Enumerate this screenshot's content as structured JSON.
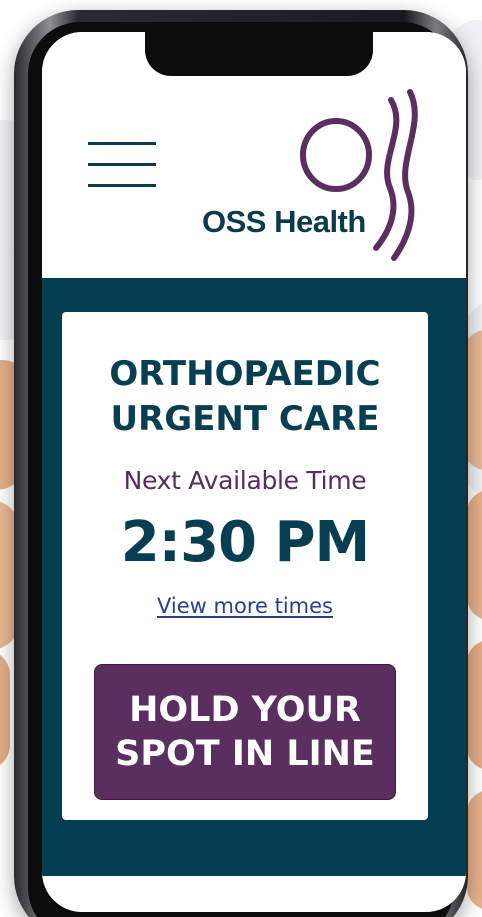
{
  "header": {
    "menu_icon": "hamburger-menu-icon",
    "logo_text": "OSS Health"
  },
  "card": {
    "title_line1": "ORTHOPAEDIC",
    "title_line2": "URGENT CARE",
    "next_available_label": "Next Available Time",
    "next_available_time": "2:30 PM",
    "view_more_link": "View more times",
    "hold_button_line1": "HOLD YOUR",
    "hold_button_line2": "SPOT IN LINE"
  },
  "colors": {
    "brand_teal": "#053e50",
    "brand_purple": "#5b2e60",
    "text_dark_teal": "#083e51",
    "link_blue": "#2a3f8f"
  }
}
